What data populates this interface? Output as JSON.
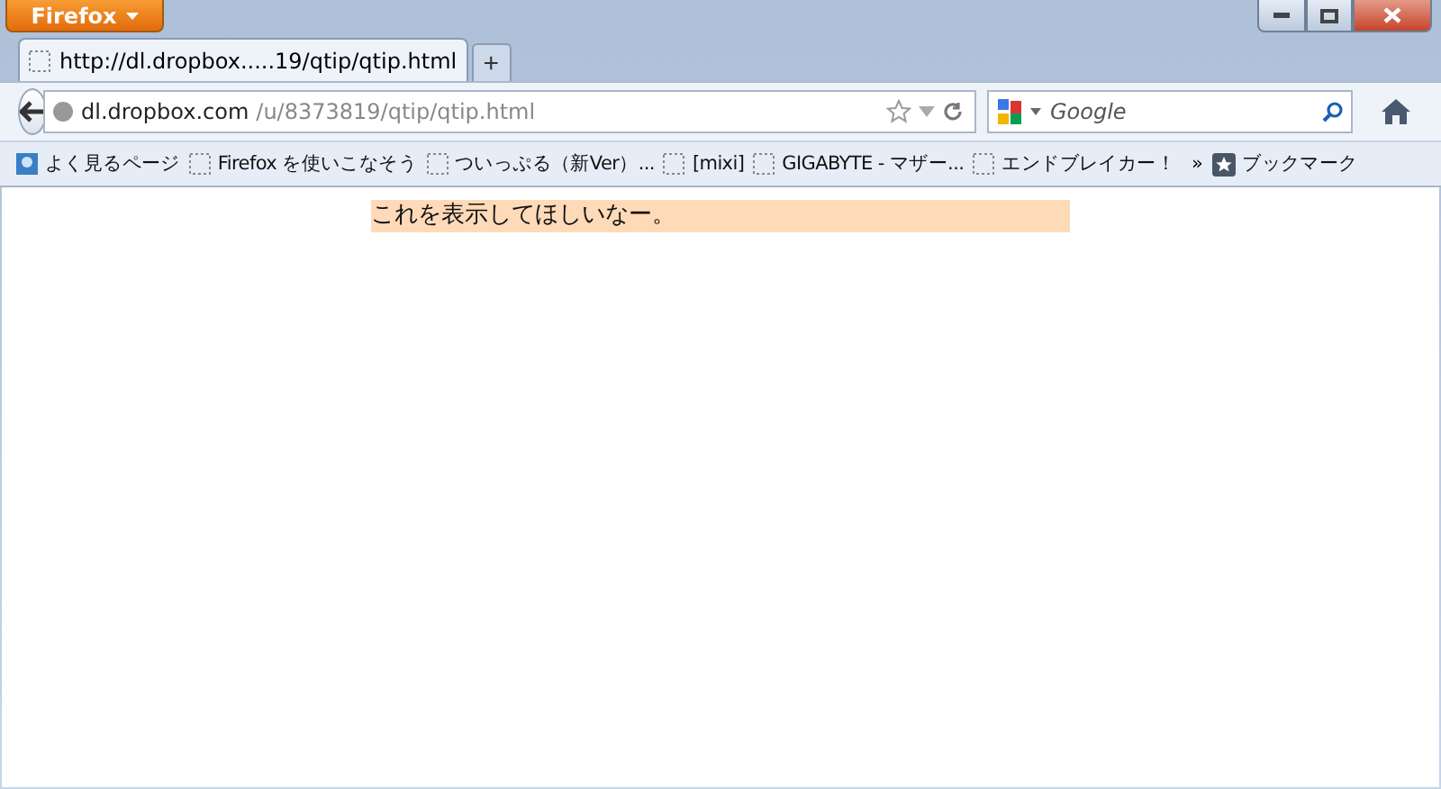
{
  "app_button": {
    "label": "Firefox"
  },
  "tabs": [
    {
      "label": "http://dl.dropbox.....19/qtip/qtip.html",
      "selected": true
    }
  ],
  "new_tab": {
    "label": "+"
  },
  "address_bar": {
    "host": "dl.dropbox.com",
    "path": "/u/8373819/qtip/qtip.html"
  },
  "search": {
    "placeholder": "Google"
  },
  "bookmarks": [
    {
      "label": "よく見るページ",
      "kind": "smart"
    },
    {
      "label": "Firefox を使いこなそう",
      "kind": "page"
    },
    {
      "label": "ついっぷる（新Ver）...",
      "kind": "page"
    },
    {
      "label": "[mixi]",
      "kind": "page"
    },
    {
      "label": "GIGABYTE - マザー...",
      "kind": "page"
    },
    {
      "label": "エンドブレイカー！",
      "kind": "page"
    }
  ],
  "overflow": {
    "label": "»"
  },
  "bookmarks_menu": {
    "label": "ブックマーク"
  },
  "content": {
    "message": "これを表示してほしいなー。"
  }
}
